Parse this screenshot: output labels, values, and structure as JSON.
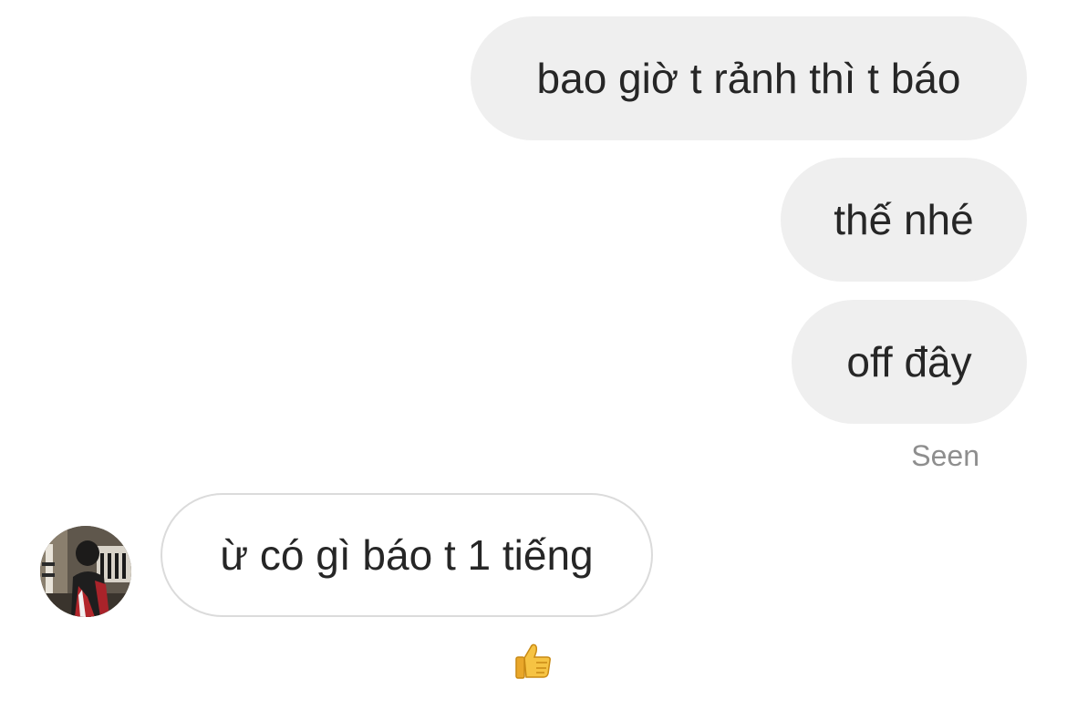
{
  "thread": {
    "messages": [
      {
        "direction": "outgoing",
        "text": "bao giờ t rảnh thì t báo"
      },
      {
        "direction": "outgoing",
        "text": "thế nhé"
      },
      {
        "direction": "outgoing",
        "text": "off đây"
      },
      {
        "direction": "incoming",
        "text": "ừ có gì báo t 1 tiếng",
        "reaction_icon": "thumbs-up-icon"
      }
    ],
    "seen_label": "Seen"
  },
  "colors": {
    "outgoing_bubble": "#efefef",
    "incoming_border": "#dbdbdb",
    "text": "#262626",
    "muted": "#8e8e8e"
  }
}
